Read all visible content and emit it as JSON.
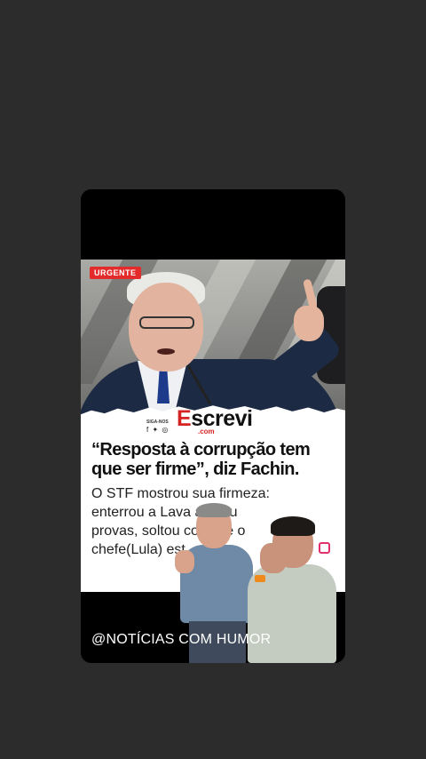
{
  "post": {
    "badge": "URGENTE",
    "brand": {
      "follow": "SIGA-NOS",
      "social_icons": "f ✦ ◎",
      "logo_first_letter": "E",
      "logo_rest": "screvi",
      "logo_suffix": ".com"
    },
    "headline": "“Resposta à corrupção tem que ser firme”, diz Fachin.",
    "caption_lines": [
      "O STF mostrou sua firmeza:",
      "enterrou a Lava        anulou",
      "provas, soltou co    tos e o",
      "chefe(Lula) est           "
    ],
    "handle": "@NOTÍCIAS COM HUMOR"
  },
  "colors": {
    "background": "#2c2c2c",
    "badge": "#e32b2b",
    "brand_accent": "#d62424"
  },
  "icons": [
    "facebook-icon",
    "twitter-icon",
    "instagram-icon"
  ]
}
